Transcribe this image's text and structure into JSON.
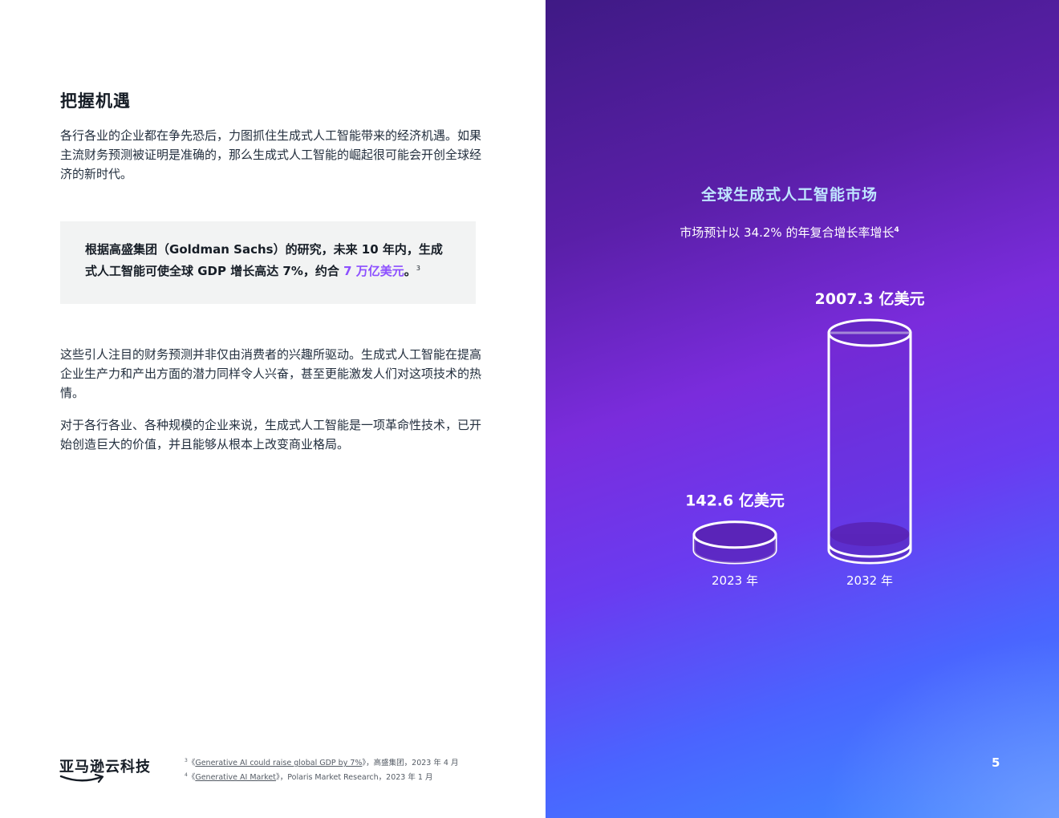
{
  "section": {
    "heading": "把握机遇",
    "paragraph1": "各行各业的企业都在争先恐后，力图抓住生成式人工智能带来的经济机遇。如果主流财务预测被证明是准确的，那么生成式人工智能的崛起很可能会开创全球经济的新时代。",
    "paragraph2": "这些引人注目的财务预测并非仅由消费者的兴趣所驱动。生成式人工智能在提高企业生产力和产出方面的潜力同样令人兴奋，甚至更能激发人们对这项技术的热情。",
    "paragraph3": "对于各行各业、各种规模的企业来说，生成式人工智能是一项革命性技术，已开始创造巨大的价值，并且能够从根本上改变商业格局。"
  },
  "callout": {
    "text": "根据高盛集团（Goldman Sachs）的研究，未来 10 年内，生成式人工智能可使全球 GDP 增长高达 7%，约合 ",
    "highlight": "7 万亿美元",
    "suffix": "。",
    "footnote_ref": "3"
  },
  "logo": {
    "text": "亚马逊云科技"
  },
  "footnotes": [
    {
      "number": "3",
      "open": "《",
      "title": "Generative AI could raise global GDP by 7%",
      "close": "》",
      "source": "，高盛集团，2023 年 4 月"
    },
    {
      "number": "4",
      "open": "《",
      "title": "Generative AI Market",
      "close": "》",
      "source": "，Polaris Market Research，2023 年 1 月"
    }
  ],
  "page_number": "5",
  "colors": {
    "highlight": "#8c4fff",
    "chart_title": "#bfe5ff",
    "panel_top": "#3f1a85",
    "panel_bottom": "#3d8dff",
    "cylinder_fill": "#5a24b8"
  },
  "chart_data": {
    "type": "bar",
    "style": "cylinder",
    "title": "全球生成式人工智能市场",
    "subtitle": "市场预计以 34.2% 的年复合增长率增长",
    "subtitle_footnote": "4",
    "categories": [
      "2023 年",
      "2032 年"
    ],
    "values": [
      142.6,
      2007.3
    ],
    "value_labels": [
      "142.6 亿美元",
      "2007.3 亿美元"
    ],
    "unit": "亿美元",
    "cagr_percent": 34.2,
    "legend": "none",
    "grid": false
  }
}
